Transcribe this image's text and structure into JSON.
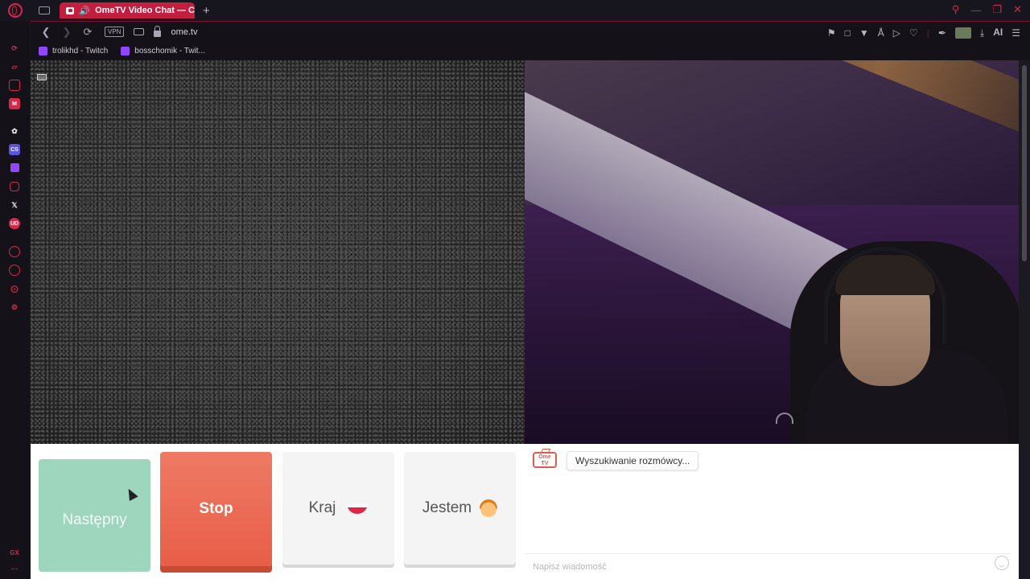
{
  "browser": {
    "tab_title": "OmeTV Video Chat — C",
    "url": "ome.tv",
    "vpn_label": "VPN",
    "ai_label": "AI",
    "new_tab_symbol": "+",
    "bookmarks": [
      {
        "label": "trolikhd - Twitch",
        "icon": "twitch-icon"
      },
      {
        "label": "bosschomik - Twit...",
        "icon": "twitch-icon"
      }
    ],
    "sidebar_bottom_label": "GX"
  },
  "controls": {
    "next_label": "Następny",
    "stop_label": "Stop",
    "country_label": "Kraj",
    "country_flag": "poland-flag",
    "iam_label": "Jestem",
    "iam_icon": "kid-emoji"
  },
  "chat": {
    "logo_text": "Ome TV",
    "status_message": "Wyszukiwanie rozmówcy...",
    "input_placeholder": "Napisz wiadomość"
  },
  "colors": {
    "accent": "#c41e3f",
    "next_button": "#9ed6bd",
    "stop_button": "#ee7a64",
    "twitch": "#9146ff"
  }
}
